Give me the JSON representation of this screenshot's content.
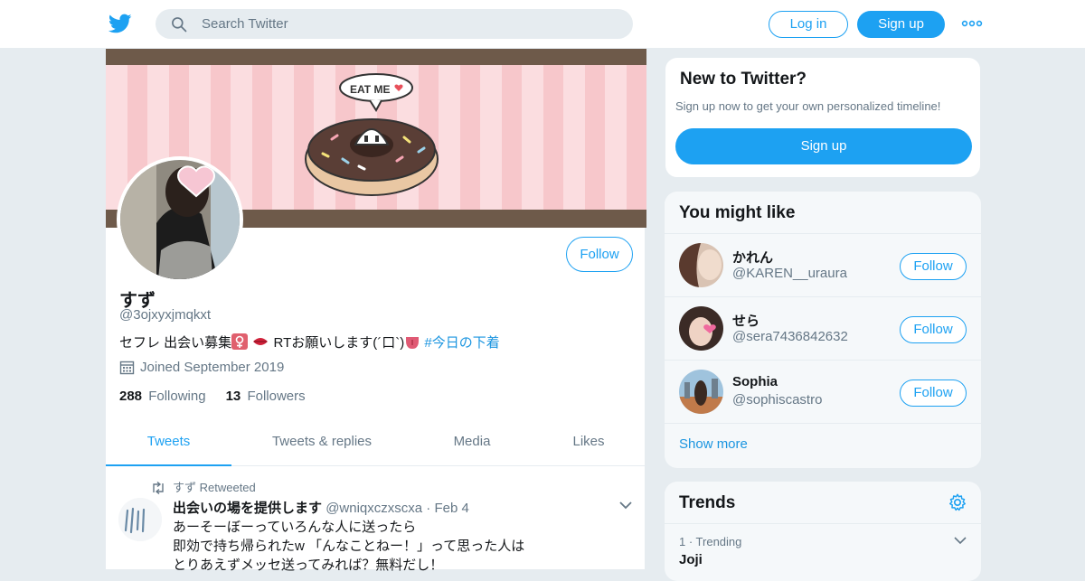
{
  "nav": {
    "search_placeholder": "Search Twitter",
    "login_label": "Log in",
    "signup_label": "Sign up",
    "more_icon": "more-dots-icon",
    "brand_color": "#1da1f2"
  },
  "profile": {
    "display_name": "すず",
    "handle": "@3ojxyxjmqkxt",
    "banner_text": "EAT ME",
    "follow_label": "Follow",
    "bio": {
      "text1": "セフレ 出会い募集",
      "text2": "RTお願いします(´口`)",
      "hashtag": "#今日の下着"
    },
    "joined": "Joined September 2019",
    "following_count": "288",
    "following_label": "Following",
    "followers_count": "13",
    "followers_label": "Followers"
  },
  "tabs": [
    {
      "label": "Tweets",
      "active": true
    },
    {
      "label": "Tweets & replies",
      "active": false
    },
    {
      "label": "Media",
      "active": false
    },
    {
      "label": "Likes",
      "active": false
    }
  ],
  "tweet": {
    "retweet_context": "すず Retweeted",
    "author_name": "出会いの場を提供します",
    "author_handle": "@wniqxczxscxa",
    "separator": "·",
    "date": "Feb 4",
    "lines": [
      "あーそーぼーっていろんな人に送ったら",
      "即効で持ち帰られたw 「んなことねー！」って思った人は",
      "とりあえずメッセ送ってみれば？無料だし！"
    ]
  },
  "new_to_twitter": {
    "title": "New to Twitter?",
    "subtitle": "Sign up now to get your own personalized timeline!",
    "button_label": "Sign up"
  },
  "you_might_like": {
    "title": "You might like",
    "items": [
      {
        "name": "かれん",
        "handle": "@KAREN__uraura",
        "follow_label": "Follow"
      },
      {
        "name": "せら",
        "handle": "@sera7436842632",
        "follow_label": "Follow"
      },
      {
        "name": "Sophia",
        "handle": "@sophiscastro",
        "follow_label": "Follow"
      }
    ],
    "show_more": "Show more"
  },
  "trends": {
    "title": "Trends",
    "items": [
      {
        "meta": "1 · Trending",
        "name": "Joji"
      }
    ]
  }
}
